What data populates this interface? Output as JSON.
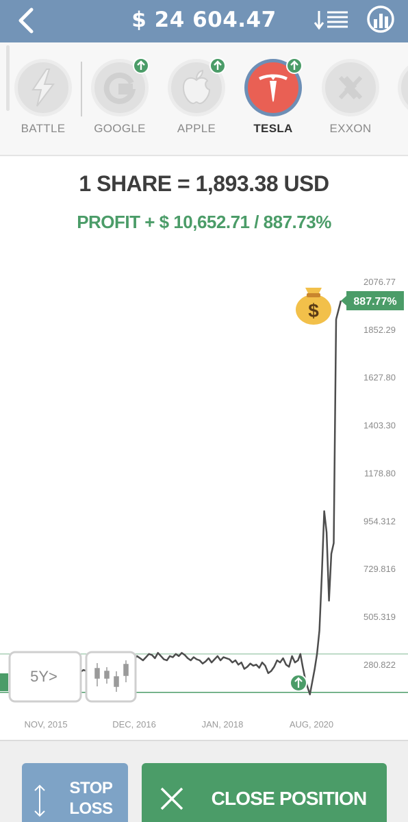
{
  "header": {
    "balance": "$ 24 604.47",
    "back_icon": "chevron-left-icon",
    "sort_icon": "sort-descending-icon",
    "stats_icon": "bar-chart-circle-icon"
  },
  "assets": [
    {
      "label": "BATTLE",
      "icon": "lightning-icon",
      "active": false,
      "badge": false
    },
    {
      "label": "GOOGLE",
      "icon": "google-logo-icon",
      "active": false,
      "badge": true
    },
    {
      "label": "APPLE",
      "icon": "apple-logo-icon",
      "active": false,
      "badge": true
    },
    {
      "label": "TESLA",
      "icon": "tesla-logo-icon",
      "active": true,
      "badge": true
    },
    {
      "label": "EXXON",
      "icon": "exxon-logo-icon",
      "active": false,
      "badge": false
    }
  ],
  "share_line": "1 SHARE = 1,893.38 USD",
  "profit_line": "PROFIT + $ 10,652.71 / 887.73%",
  "chart_data": {
    "type": "line",
    "y_ticks": [
      "2076.77",
      "1852.29",
      "1627.80",
      "1403.30",
      "1178.80",
      "954.312",
      "729.816",
      "505.319",
      "280.822"
    ],
    "x_ticks": [
      "NOV, 2015",
      "DEC, 2016",
      "JAN, 2018",
      "AUG, 2020"
    ],
    "current_badge": "887.77%",
    "reference_lines": [
      {
        "value": 330
      },
      {
        "value": 150
      }
    ],
    "series": [
      {
        "color": "#4d4d4d",
        "x": [
          2016.0,
          2016.05,
          2016.1,
          2016.15,
          2016.2,
          2016.25,
          2016.3,
          2016.35,
          2016.4,
          2016.45,
          2016.5,
          2016.55,
          2016.6,
          2016.65,
          2016.7,
          2016.75,
          2016.8,
          2016.85,
          2016.9,
          2016.95,
          2017.0,
          2017.05,
          2017.1,
          2017.15,
          2017.2,
          2017.25,
          2017.3,
          2017.35,
          2017.4,
          2017.45,
          2017.5,
          2017.55,
          2017.6,
          2017.65,
          2017.7,
          2017.75,
          2017.8,
          2017.85,
          2017.9,
          2017.95,
          2018.0,
          2018.05,
          2018.1,
          2018.15,
          2018.2,
          2018.25,
          2018.3,
          2018.35,
          2018.4,
          2018.45,
          2018.5,
          2018.55,
          2018.6,
          2018.65,
          2018.7,
          2018.75,
          2018.8,
          2018.85,
          2018.9,
          2018.95,
          2019.0,
          2019.05,
          2019.1,
          2019.15,
          2019.2,
          2019.25,
          2019.3,
          2019.35,
          2019.4,
          2019.45,
          2019.5,
          2019.55,
          2019.6,
          2019.65,
          2019.7,
          2019.75,
          2019.8,
          2019.85,
          2019.9,
          2019.95,
          2020.0,
          2020.04,
          2020.08,
          2020.12,
          2020.16,
          2020.2,
          2020.24,
          2020.28,
          2020.32,
          2020.36,
          2020.4,
          2020.44,
          2020.48,
          2020.52,
          2020.56,
          2020.6,
          2020.64
        ],
        "y": [
          180,
          190,
          205,
          200,
          220,
          235,
          230,
          245,
          255,
          250,
          265,
          270,
          262,
          255,
          275,
          280,
          265,
          270,
          260,
          245,
          262,
          275,
          285,
          310,
          300,
          305,
          320,
          310,
          300,
          315,
          330,
          325,
          310,
          335,
          320,
          305,
          300,
          320,
          315,
          330,
          320,
          335,
          325,
          310,
          300,
          315,
          305,
          300,
          285,
          295,
          310,
          290,
          305,
          320,
          300,
          315,
          310,
          305,
          290,
          300,
          280,
          290,
          260,
          270,
          285,
          275,
          280,
          265,
          290,
          275,
          240,
          250,
          270,
          300,
          290,
          310,
          280,
          270,
          320,
          290,
          300,
          330,
          270,
          215,
          175,
          140,
          200,
          260,
          330,
          440,
          700,
          1000,
          900,
          580,
          800,
          850,
          1900
        ]
      }
    ]
  },
  "chart_controls": {
    "period_label": "5Y>",
    "candle_icon": "candlestick-icon"
  },
  "markers": {
    "money_bag_icon": "money-bag-icon",
    "entry_icon": "up-arrow-circle-icon"
  },
  "buttons": {
    "stop_loss": [
      "STOP",
      "LOSS"
    ],
    "close_position": "CLOSE POSITION",
    "stop_icon": "up-down-arrow-icon",
    "close_icon": "close-x-icon"
  },
  "colors": {
    "header": "#7394b7",
    "green": "#4b9c68",
    "tesla_red": "#e96054",
    "stop_blue": "#7ea3c6"
  }
}
